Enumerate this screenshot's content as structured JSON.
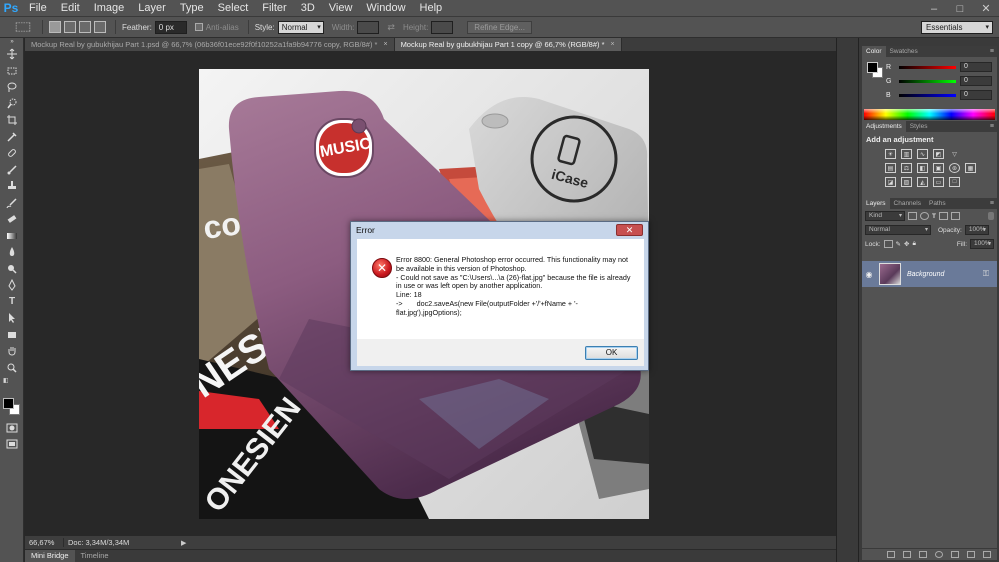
{
  "app": {
    "logo": "Ps"
  },
  "menu": [
    "File",
    "Edit",
    "Image",
    "Layer",
    "Type",
    "Select",
    "Filter",
    "3D",
    "View",
    "Window",
    "Help"
  ],
  "window_controls": {
    "minimize": "–",
    "maximize": "□",
    "close": "✕"
  },
  "options": {
    "feather_label": "Feather:",
    "feather_value": "0 px",
    "antialias_label": "Anti-alias",
    "style_label": "Style:",
    "style_value": "Normal",
    "width_label": "Width:",
    "height_label": "Height:",
    "refine_edge": "Refine Edge...",
    "workspace": "Essentials"
  },
  "tabs": [
    {
      "label": "Mockup Real by gubukhijau Part 1.psd @ 66,7% (06b36f01ece92f0f10252a1fa9b94776 copy, RGB/8#) *",
      "active": false
    },
    {
      "label": "Mockup Real by gubukhijau Part 1 copy @ 66,7% (RGB/8#) *",
      "active": true
    }
  ],
  "tab_close": "×",
  "status": {
    "zoom": "66,67%",
    "doc": "Doc: 3,34M/3,34M",
    "arrow": "▶"
  },
  "bottom_tabs": [
    "Mini Bridge",
    "Timeline"
  ],
  "color_panel": {
    "tabs": [
      "Color",
      "Swatches"
    ],
    "channels": [
      {
        "label": "R",
        "value": "0",
        "color": "#ff0000"
      },
      {
        "label": "G",
        "value": "0",
        "color": "#00ff00"
      },
      {
        "label": "B",
        "value": "0",
        "color": "#0000ff"
      }
    ]
  },
  "adjustments_panel": {
    "tabs": [
      "Adjustments",
      "Styles"
    ],
    "title": "Add an adjustment"
  },
  "layers_panel": {
    "tabs": [
      "Layers",
      "Channels",
      "Paths"
    ],
    "kind": "Kind",
    "blend_mode": "Normal",
    "opacity_label": "Opacity:",
    "opacity_value": "100%",
    "lock_label": "Lock:",
    "fill_label": "Fill:",
    "fill_value": "100%",
    "layer_name": "Background"
  },
  "dialog": {
    "title": "Error",
    "close": "✕",
    "lines": [
      "Error 8800: General Photoshop error occurred. This functionality may not be available in this version of Photoshop.",
      "- Could not save as \"C:\\Users\\...\\a (26)-flat.jpg\" because the file is already in use or was left open by another application.",
      "Line: 18",
      "->       doc2.saveAs(new File(outputFolder +'/'+fName + '-flat.jpg'),jpgOptions);"
    ],
    "ok": "OK"
  },
  "photo_texts": {
    "case_brand": "iCase",
    "mag1": "con",
    "mag2": "NESIA",
    "mag3": "ONESIEN",
    "mag4": "MUSIC"
  }
}
